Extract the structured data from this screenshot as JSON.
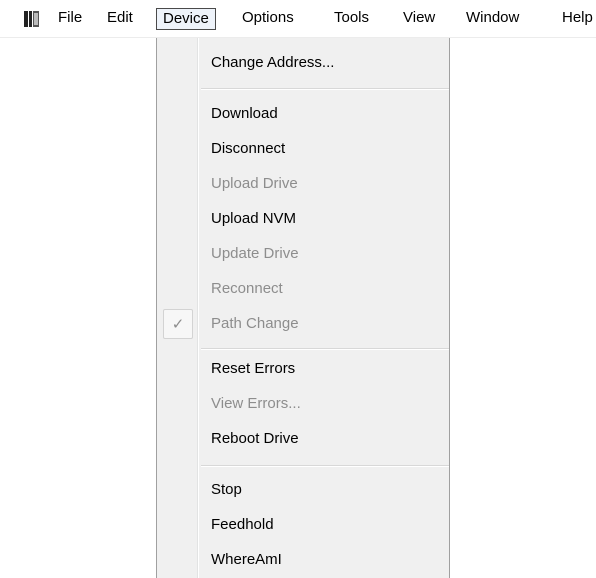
{
  "menubar": {
    "app_icon": "app-window-icon",
    "items": [
      {
        "label": "File"
      },
      {
        "label": "Edit"
      },
      {
        "label": "Device",
        "active": true
      },
      {
        "label": "Options"
      },
      {
        "label": "Tools"
      },
      {
        "label": "View"
      },
      {
        "label": "Window"
      },
      {
        "label": "Help"
      }
    ]
  },
  "device_menu": {
    "items": [
      {
        "label": "Change Address...",
        "enabled": true
      },
      {
        "label": "Download",
        "enabled": true
      },
      {
        "label": "Disconnect",
        "enabled": true
      },
      {
        "label": "Upload Drive",
        "enabled": false
      },
      {
        "label": "Upload NVM",
        "enabled": true
      },
      {
        "label": "Update Drive",
        "enabled": false
      },
      {
        "label": "Reconnect",
        "enabled": false
      },
      {
        "label": "Path Change",
        "enabled": false,
        "checked": true,
        "check_glyph": "✓"
      },
      {
        "label": "Reset Errors",
        "enabled": true
      },
      {
        "label": "View Errors...",
        "enabled": false
      },
      {
        "label": "Reboot Drive",
        "enabled": true
      },
      {
        "label": "Stop",
        "enabled": true
      },
      {
        "label": "Feedhold",
        "enabled": true
      },
      {
        "label": "WhereAmI",
        "enabled": true
      }
    ]
  },
  "colors": {
    "menu_background": "#f0f0f0",
    "disabled_text": "#8d8d8d",
    "active_menubar_border": "#4a4a4a"
  }
}
